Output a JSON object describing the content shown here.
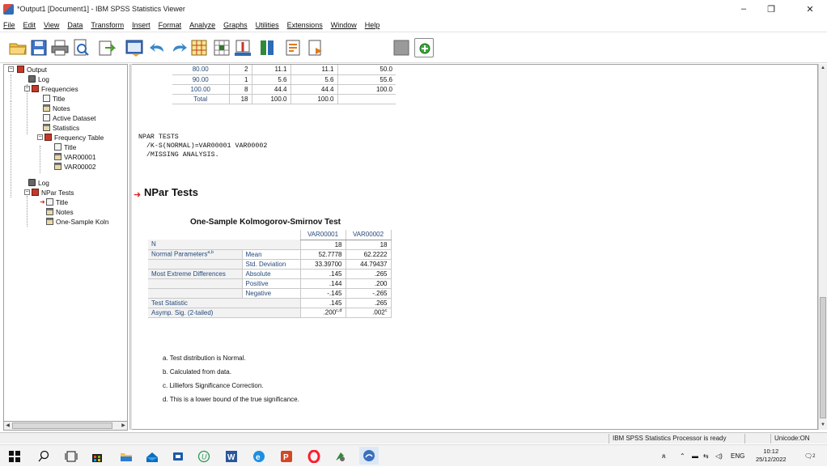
{
  "window": {
    "title": "*Output1 [Document1] - IBM SPSS Statistics Viewer",
    "minimize": "–",
    "maximize": "❐",
    "close": "✕"
  },
  "menu": [
    "File",
    "Edit",
    "View",
    "Data",
    "Transform",
    "Insert",
    "Format",
    "Analyze",
    "Graphs",
    "Utilities",
    "Extensions",
    "Window",
    "Help"
  ],
  "toolbar": {
    "icons": [
      "open-folder-icon",
      "save-icon",
      "print-icon",
      "print-preview-icon",
      "export-icon",
      "recall-dialog-icon",
      "undo-icon",
      "redo-icon",
      "goto-data-icon",
      "goto-case-icon",
      "variables-icon",
      "output-list-icon",
      "show-all-icon",
      "promote-icon",
      "demote-icon",
      "insert-output-icon"
    ]
  },
  "outline": {
    "items": [
      {
        "label": "Output",
        "icon": "output-book-icon"
      },
      {
        "label": "Log",
        "icon": "log-icon"
      },
      {
        "label": "Frequencies",
        "icon": "folder-icon"
      },
      {
        "label": "Title",
        "icon": "title-icon"
      },
      {
        "label": "Notes",
        "icon": "notes-icon"
      },
      {
        "label": "Active Dataset",
        "icon": "page-icon"
      },
      {
        "label": "Statistics",
        "icon": "table-icon"
      },
      {
        "label": "Frequency Table",
        "icon": "folder-icon"
      },
      {
        "label": "Title",
        "icon": "title-icon"
      },
      {
        "label": "VAR00001",
        "icon": "table-icon"
      },
      {
        "label": "VAR00002",
        "icon": "table-icon"
      },
      {
        "label": "Log",
        "icon": "log-icon"
      },
      {
        "label": "NPar Tests",
        "icon": "folder-icon"
      },
      {
        "label": "Title",
        "icon": "title-icon"
      },
      {
        "label": "Notes",
        "icon": "notes-icon"
      },
      {
        "label": "One-Sample Koln",
        "icon": "table-icon"
      }
    ]
  },
  "freq_table": {
    "rows": [
      {
        "value": "80.00",
        "freq": "2",
        "percent": "11.1",
        "valid": "11.1",
        "cum": "50.0"
      },
      {
        "value": "90.00",
        "freq": "1",
        "percent": "5.6",
        "valid": "5.6",
        "cum": "55.6"
      },
      {
        "value": "100.00",
        "freq": "8",
        "percent": "44.4",
        "valid": "44.4",
        "cum": "100.0"
      },
      {
        "value": "Total",
        "freq": "18",
        "percent": "100.0",
        "valid": "100.0",
        "cum": ""
      }
    ]
  },
  "syntax": {
    "line1": "NPAR TESTS",
    "line2": "  /K-S(NORMAL)=VAR00001 VAR00002",
    "line3": "  /MISSING ANALYSIS."
  },
  "section_title": "NPar Tests",
  "ks": {
    "title": "One-Sample Kolmogorov-Smirnov Test",
    "col1": "VAR00001",
    "col2": "VAR00002",
    "n_label": "N",
    "n1": "18",
    "n2": "18",
    "np_label": "Normal Parameters",
    "np_sup": "a,b",
    "mean_label": "Mean",
    "mean1": "52.7778",
    "mean2": "62.2222",
    "sd_label": "Std. Deviation",
    "sd1": "33.39700",
    "sd2": "44.79437",
    "med_label": "Most Extreme Differences",
    "abs_label": "Absolute",
    "abs1": ".145",
    "abs2": ".265",
    "pos_label": "Positive",
    "pos1": ".144",
    "pos2": ".200",
    "neg_label": "Negative",
    "neg1": "-.145",
    "neg2": "-.265",
    "ts_label": "Test Statistic",
    "ts1": ".145",
    "ts2": ".265",
    "sig_label": "Asymp. Sig. (2-tailed)",
    "sig1": ".200",
    "sig1_sup": "c,d",
    "sig2": ".002",
    "sig2_sup": "c"
  },
  "footnotes": [
    "a. Test distribution is Normal.",
    "b. Calculated from data.",
    "c. Lilliefors Significance Correction.",
    "d. This is a lower bound of the true significance."
  ],
  "status": {
    "processor": "IBM SPSS Statistics Processor is ready",
    "unicode": "Unicode:ON"
  },
  "taskbar": {
    "icons": [
      "windows-start-icon",
      "search-icon",
      "task-view-icon",
      "store-icon",
      "file-explorer-icon",
      "mail-icon",
      "media-icon",
      "app-u-icon",
      "word-icon",
      "edge-icon",
      "powerpoint-icon",
      "opera-icon",
      "pinned-app-icon",
      "spss-icon"
    ],
    "lang": "ENG",
    "time": "10:12",
    "date": "25/12/2022",
    "notification_count": "2"
  },
  "colors": {
    "table_label_blue": "#264a7a",
    "red_arrow": "#e02020"
  }
}
